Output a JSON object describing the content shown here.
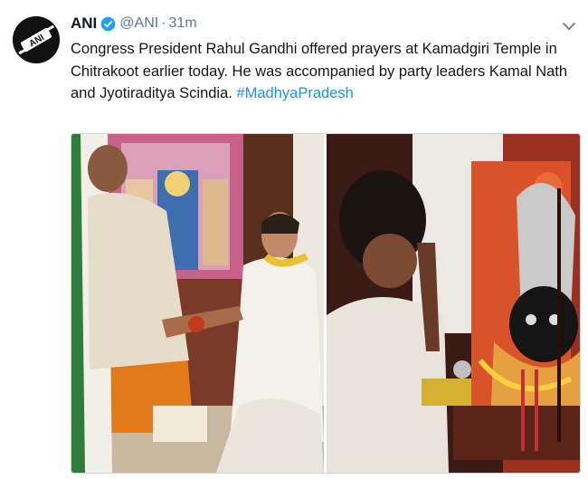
{
  "tweet": {
    "author_name": "ANI",
    "handle": "@ANI",
    "separator": "·",
    "time": "31m",
    "verified": true,
    "avatar_icon": "ani-logo-icon",
    "menu_icon": "chevron-down-icon",
    "text": "Congress President Rahul Gandhi offered prayers at Kamadgiri Temple in Chitrakoot earlier today. He was accompanied by party leaders Kamal Nath and Jyotiraditya Scindia. ",
    "hashtag": "#MadhyaPradesh",
    "colors": {
      "text": "#14171a",
      "secondary": "#657786",
      "link": "#1b95e0",
      "verified": "#1da1f2"
    }
  }
}
